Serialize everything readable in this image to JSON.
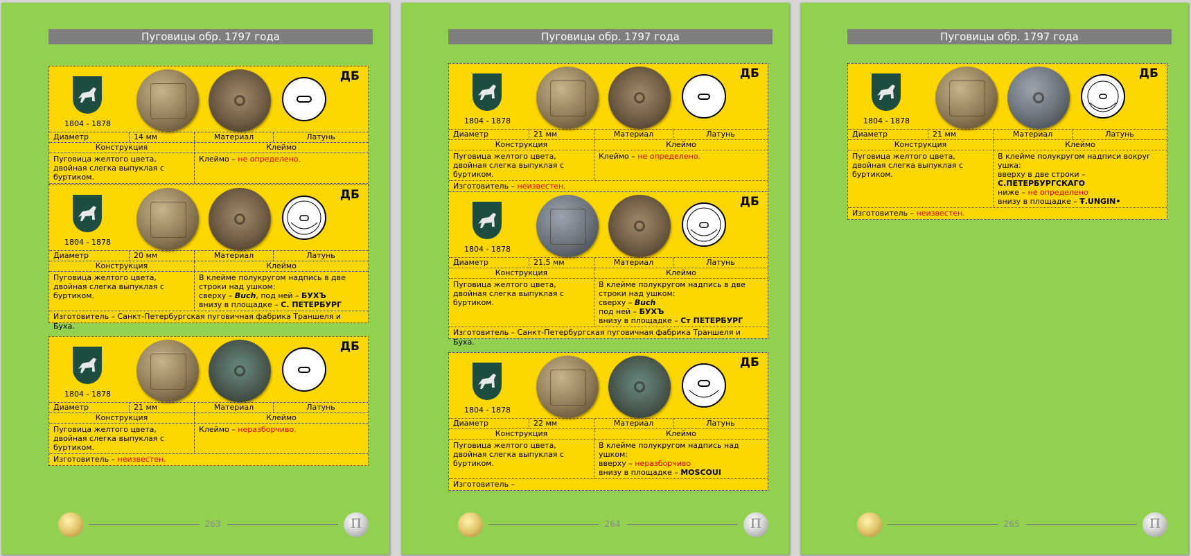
{
  "pages": [
    {
      "header": "Пуговицы обр. 1797 года",
      "page_number": "263",
      "cards": [
        {
          "years": "1804 - 1878",
          "mark": "ДБ",
          "diam_label": "Диаметр",
          "diam": "14 мм",
          "mat_label": "Материал",
          "mat": "Латунь",
          "constr_label": "Конструкция",
          "klej_label": "Клеймо",
          "constr": "Пуговица желтого цвета, двойная слегка выпуклая с буртиком.",
          "klej": [
            {
              "t": "Клеймо – "
            },
            {
              "t": "не определено.",
              "s": "red"
            }
          ],
          "maker": [
            {
              "t": "Изготовитель – "
            },
            {
              "t": "неизвестен.",
              "s": "red"
            }
          ]
        },
        {
          "years": "1804 - 1878",
          "mark": "ДБ",
          "diam_label": "Диаметр",
          "diam": "20 мм",
          "mat_label": "Материал",
          "mat": "Латунь",
          "constr_label": "Конструкция",
          "klej_label": "Клеймо",
          "constr": "Пуговица желтого цвета, двойная слегка выпуклая с буртиком.",
          "klej": [
            {
              "t": "В клейме полукругом надпись в две строки над ушком:"
            },
            {
              "t": "сверху – ",
              "br": true
            },
            {
              "t": "Buch",
              "s": "bi"
            },
            {
              "t": ", под ней – "
            },
            {
              "t": "БУХЪ",
              "s": "b"
            },
            {
              "t": "внизу в площадке – ",
              "br": true
            },
            {
              "t": "С. ПЕТЕРБУРГ",
              "s": "b"
            }
          ],
          "maker": [
            {
              "t": "Изготовитель – Санкт-Петербургская пуговичная фабрика Траншеля и Буха."
            }
          ]
        },
        {
          "years": "1804 - 1878",
          "mark": "ДБ",
          "diam_label": "Диаметр",
          "diam": "21 мм",
          "mat_label": "Материал",
          "mat": "Латунь",
          "constr_label": "Конструкция",
          "klej_label": "Клеймо",
          "constr": "Пуговица желтого цвета, двойная слегка выпуклая с буртиком.",
          "klej": [
            {
              "t": "Клеймо – "
            },
            {
              "t": "неразборчиво.",
              "s": "red"
            }
          ],
          "maker": [
            {
              "t": "Изготовитель – "
            },
            {
              "t": "неизвестен.",
              "s": "red"
            }
          ]
        }
      ]
    },
    {
      "header": "Пуговицы обр. 1797 года",
      "page_number": "264",
      "cards": [
        {
          "years": "1804 - 1878",
          "mark": "ДБ",
          "diam_label": "Диаметр",
          "diam": "21 мм",
          "mat_label": "Материал",
          "mat": "Латунь",
          "constr_label": "Конструкция",
          "klej_label": "Клеймо",
          "constr": "Пуговица желтого цвета, двойная слегка выпуклая с буртиком.",
          "klej": [
            {
              "t": "Клеймо – "
            },
            {
              "t": "не определено.",
              "s": "red"
            }
          ],
          "maker": [
            {
              "t": "Изготовитель – "
            },
            {
              "t": "неизвестен.",
              "s": "red"
            }
          ]
        },
        {
          "years": "1804 - 1878",
          "mark": "ДБ",
          "diam_label": "Диаметр",
          "diam": "21,5 мм",
          "mat_label": "Материал",
          "mat": "Латунь",
          "constr_label": "Конструкция",
          "klej_label": "Клеймо",
          "constr": "Пуговица желтого цвета, двойная слегка выпуклая с буртиком.",
          "klej": [
            {
              "t": "В клейме полукругом надпись в две строки над ушком:"
            },
            {
              "t": "сверху – ",
              "br": true
            },
            {
              "t": "Buch",
              "s": "bi"
            },
            {
              "t": "под ней – ",
              "br": true
            },
            {
              "t": "БУХЪ",
              "s": "b"
            },
            {
              "t": "внизу в площадке – ",
              "br": true
            },
            {
              "t": "Ст ПЕТЕРБУРГ",
              "s": "b"
            }
          ],
          "maker": [
            {
              "t": "Изготовитель – Санкт-Петербургская пуговичная фабрика Траншеля и Буха."
            }
          ]
        },
        {
          "years": "1804 - 1878",
          "mark": "ДБ",
          "diam_label": "Диаметр",
          "diam": "22 мм",
          "mat_label": "Материал",
          "mat": "Латунь",
          "constr_label": "Конструкция",
          "klej_label": "Клеймо",
          "constr": "Пуговица желтого цвета, двойная слегка выпуклая с буртиком.",
          "klej": [
            {
              "t": "В клейме полукругом надпись над ушком:"
            },
            {
              "t": "вверху – ",
              "br": true
            },
            {
              "t": "неразборчиво",
              "s": "red"
            },
            {
              "t": "внизу в площадке – ",
              "br": true
            },
            {
              "t": "MOSCOUI",
              "s": "b"
            }
          ],
          "maker": [
            {
              "t": "Изготовитель –"
            }
          ]
        }
      ]
    },
    {
      "header": "Пуговицы обр. 1797 года",
      "page_number": "265",
      "cards": [
        {
          "years": "1804 - 1878",
          "mark": "ДБ",
          "diam_label": "Диаметр",
          "diam": "21 мм",
          "mat_label": "Материал",
          "mat": "Латунь",
          "constr_label": "Конструкция",
          "klej_label": "Клеймо",
          "constr": "Пуговица желтого цвета, двойная слегка выпуклая с буртиком.",
          "klej": [
            {
              "t": "В клейме полукругом надписи вокруг ушка:"
            },
            {
              "t": "вверху в две строки – ",
              "br": true
            },
            {
              "t": "С.ПЕТЕРБУРГСКАГО",
              "s": "b"
            },
            {
              "t": "ниже – ",
              "br": true
            },
            {
              "t": "не определено",
              "s": "red"
            },
            {
              "t": "внизу в площадке – ",
              "br": true
            },
            {
              "t": "Ŧ.UNGIN•",
              "s": "b"
            }
          ],
          "maker": [
            {
              "t": "Изготовитель – "
            },
            {
              "t": "неизвестен.",
              "s": "red"
            }
          ]
        }
      ]
    }
  ]
}
